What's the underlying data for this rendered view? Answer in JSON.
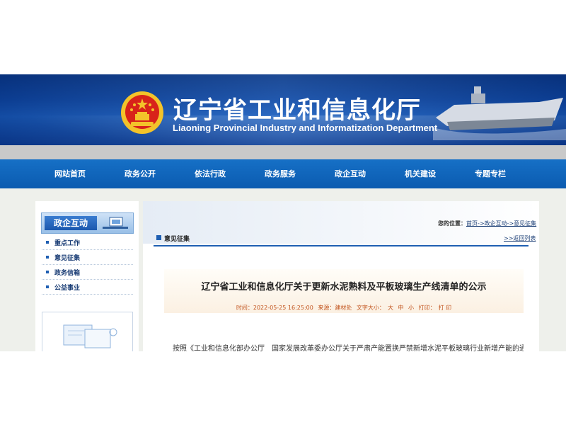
{
  "header": {
    "title_cn": "辽宁省工业和信息化厅",
    "title_en": "Liaoning Provincial Industry and Informatization Department",
    "colors": {
      "banner": "#0f4aa6",
      "nav": "#1168c0",
      "emblem_red": "#d8231a",
      "emblem_gold": "#f3c32a"
    }
  },
  "nav": {
    "items": [
      "网站首页",
      "政务公开",
      "依法行政",
      "政务服务",
      "政企互动",
      "机关建设",
      "专题专栏"
    ]
  },
  "sidebar": {
    "heading": "政企互动",
    "items": [
      "重点工作",
      "意见征集",
      "政务信箱",
      "公益事业"
    ]
  },
  "breadcrumb": {
    "label": "您的位置：",
    "path": "首页->政企互动->意见征集"
  },
  "section": {
    "title": "意见征集",
    "back": ">>返回列表"
  },
  "article": {
    "title": "辽宁省工业和信息化厅关于更新水泥熟料及平板玻璃生产线清单的公示",
    "time_label": "时间：2022-05-25 16:25:00",
    "source_label": "来源：建材处",
    "size_label": "文字大小：",
    "size_large": "大",
    "size_medium": "中",
    "size_small": "小",
    "print_label": "打印：",
    "print_action": "打 印",
    "body_first_line": "按照《工业和信息化部办公厅　国家发展改革委办公厅关于严肃产能置换严禁新增水泥平板玻璃行业新增产能的通知》"
  }
}
